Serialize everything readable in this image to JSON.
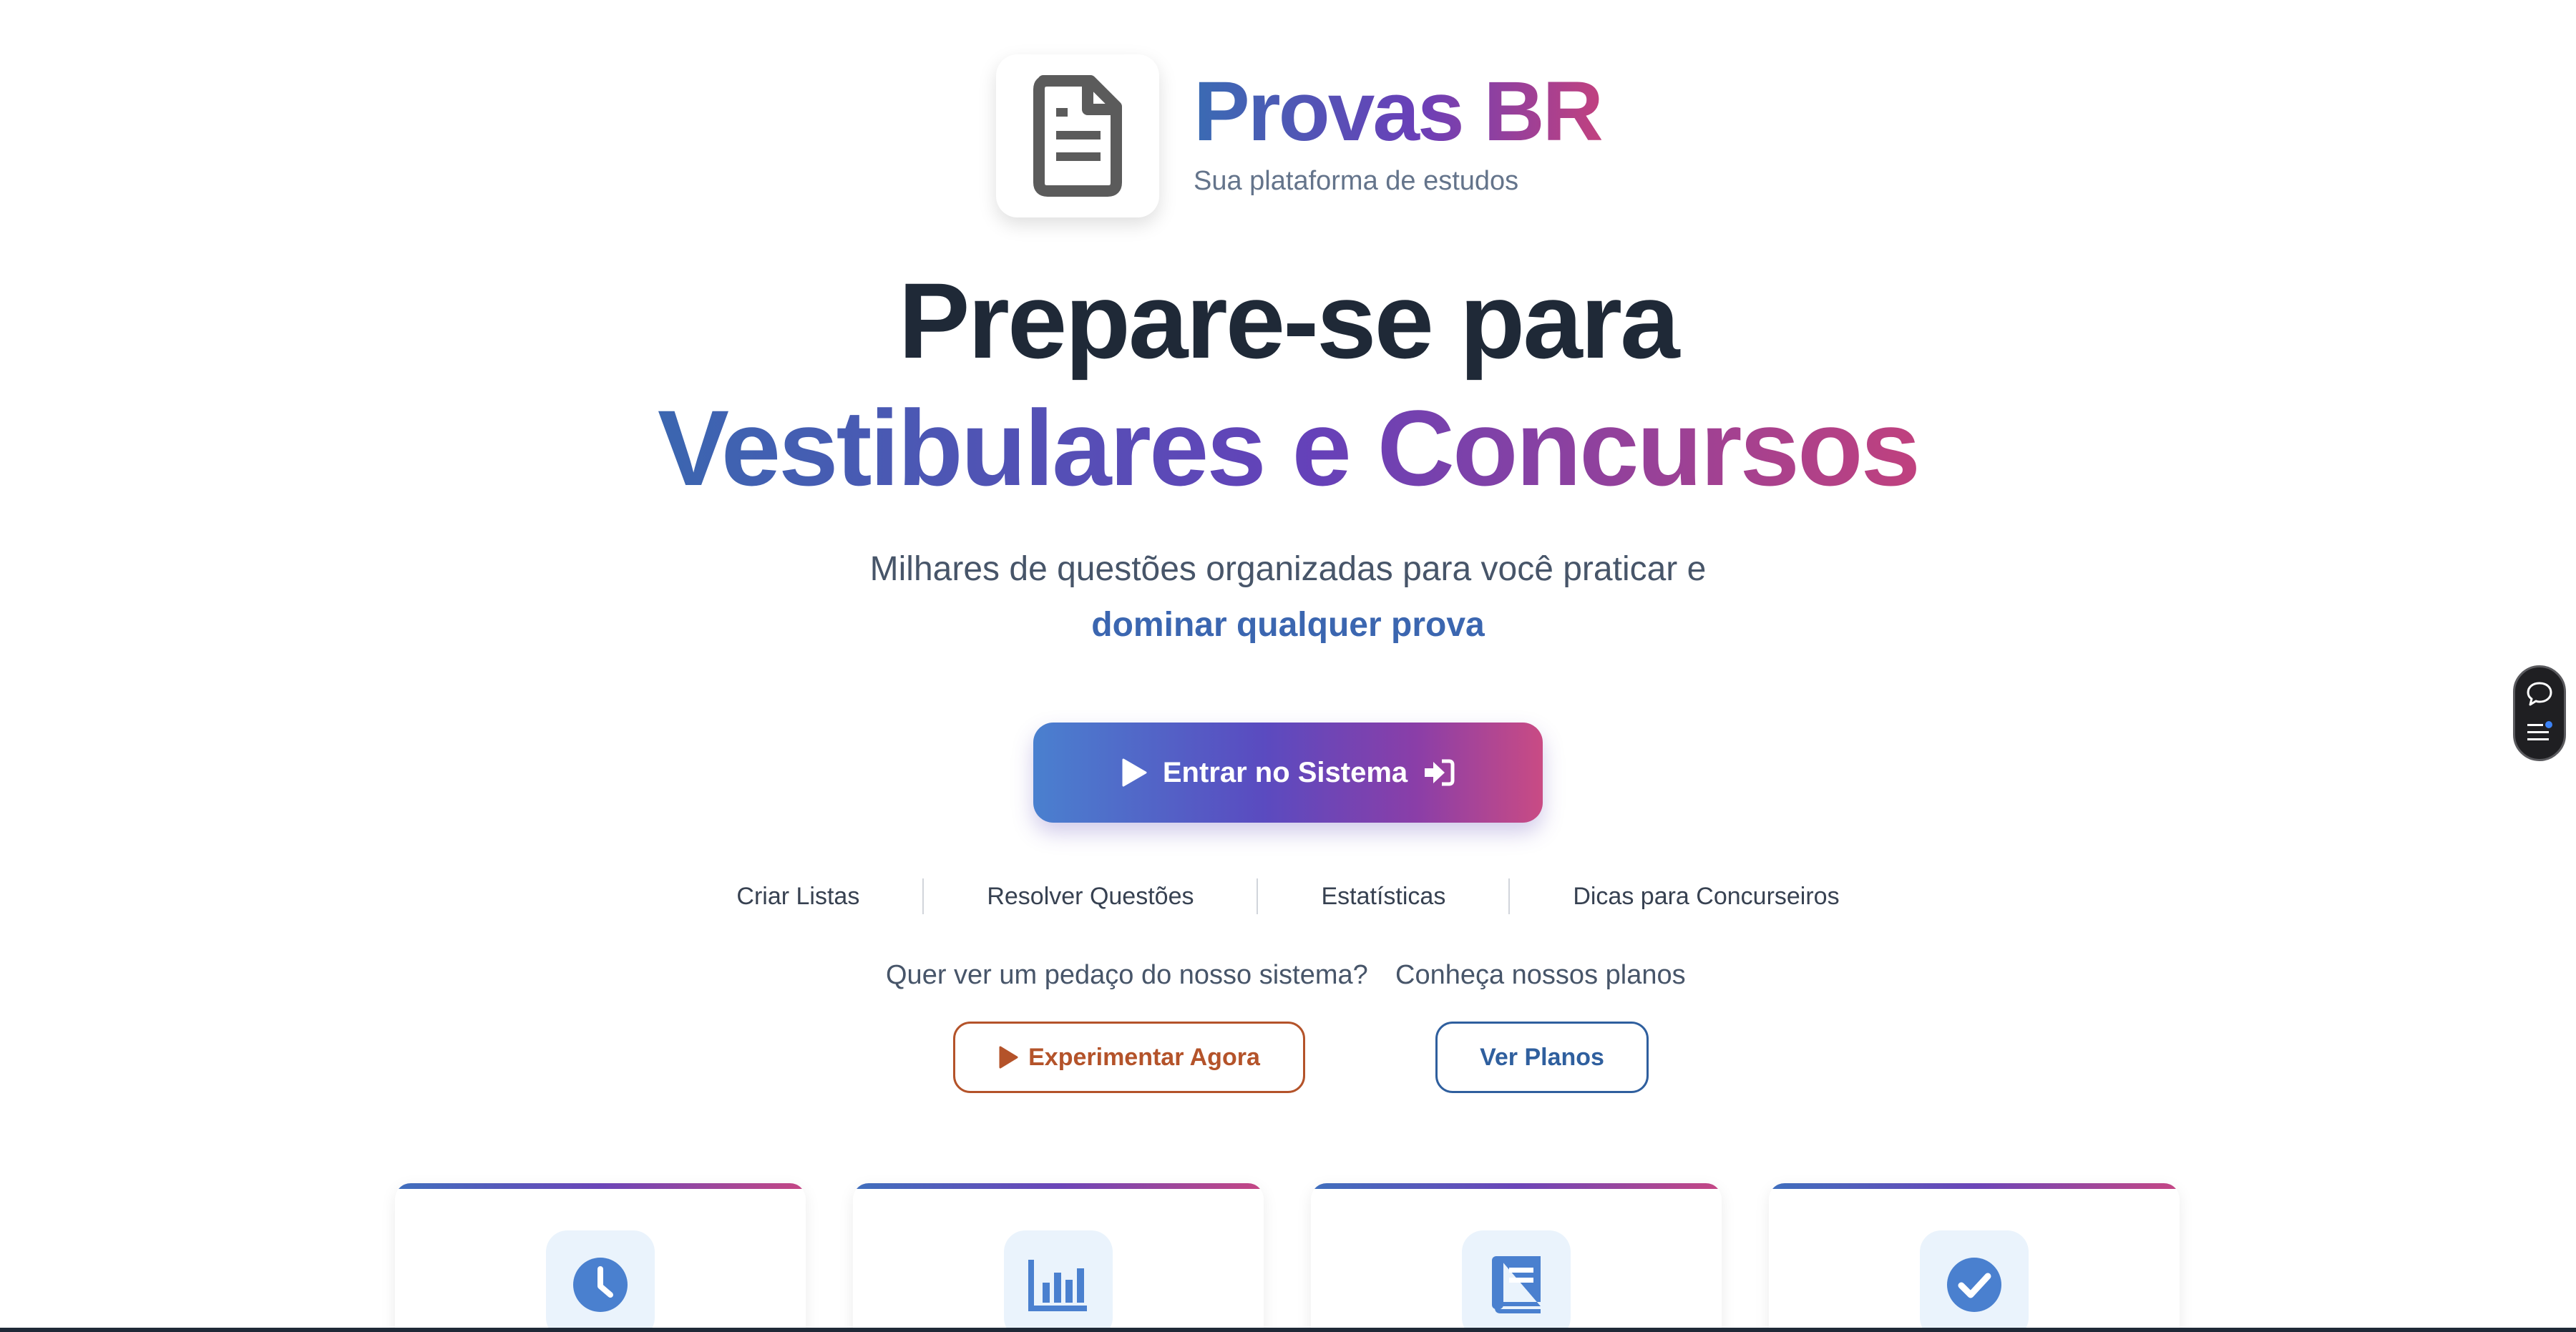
{
  "brand": {
    "name": "Provas BR",
    "tagline": "Sua plataforma de estudos",
    "logo_icon": "document-icon"
  },
  "hero": {
    "line1": "Prepare-se para",
    "line2": "Vestibulares e Concursos",
    "subtitle_line1": "Milhares de questões organizadas para você praticar e",
    "subtitle_highlight": "dominar qualquer prova"
  },
  "cta": {
    "label": "Entrar no Sistema",
    "leading_icon": "play-icon",
    "trailing_icon": "sign-in-icon"
  },
  "features": [
    "Criar Listas",
    "Resolver Questões",
    "Estatísticas",
    "Dicas para Concurseiros"
  ],
  "demo": {
    "question": "Quer ver um pedaço do nosso sistema?",
    "button": "Experimentar Agora"
  },
  "plans": {
    "question": "Conheça nossos planos",
    "button": "Ver Planos"
  },
  "cards": [
    {
      "icon": "clock-icon"
    },
    {
      "icon": "bar-chart-icon"
    },
    {
      "icon": "book-icon"
    },
    {
      "icon": "check-circle-icon"
    }
  ],
  "widget": {
    "icons": [
      "chat-bubble-icon",
      "list-icon"
    ]
  },
  "colors": {
    "gradient_start": "#3b66b0",
    "gradient_mid": "#6541b9",
    "gradient_end": "#c0417e",
    "heading": "#1f2937",
    "accent_orange": "#b4532a",
    "accent_blue": "#2f5f9e",
    "card_icon_bg": "#eaf3fc"
  }
}
